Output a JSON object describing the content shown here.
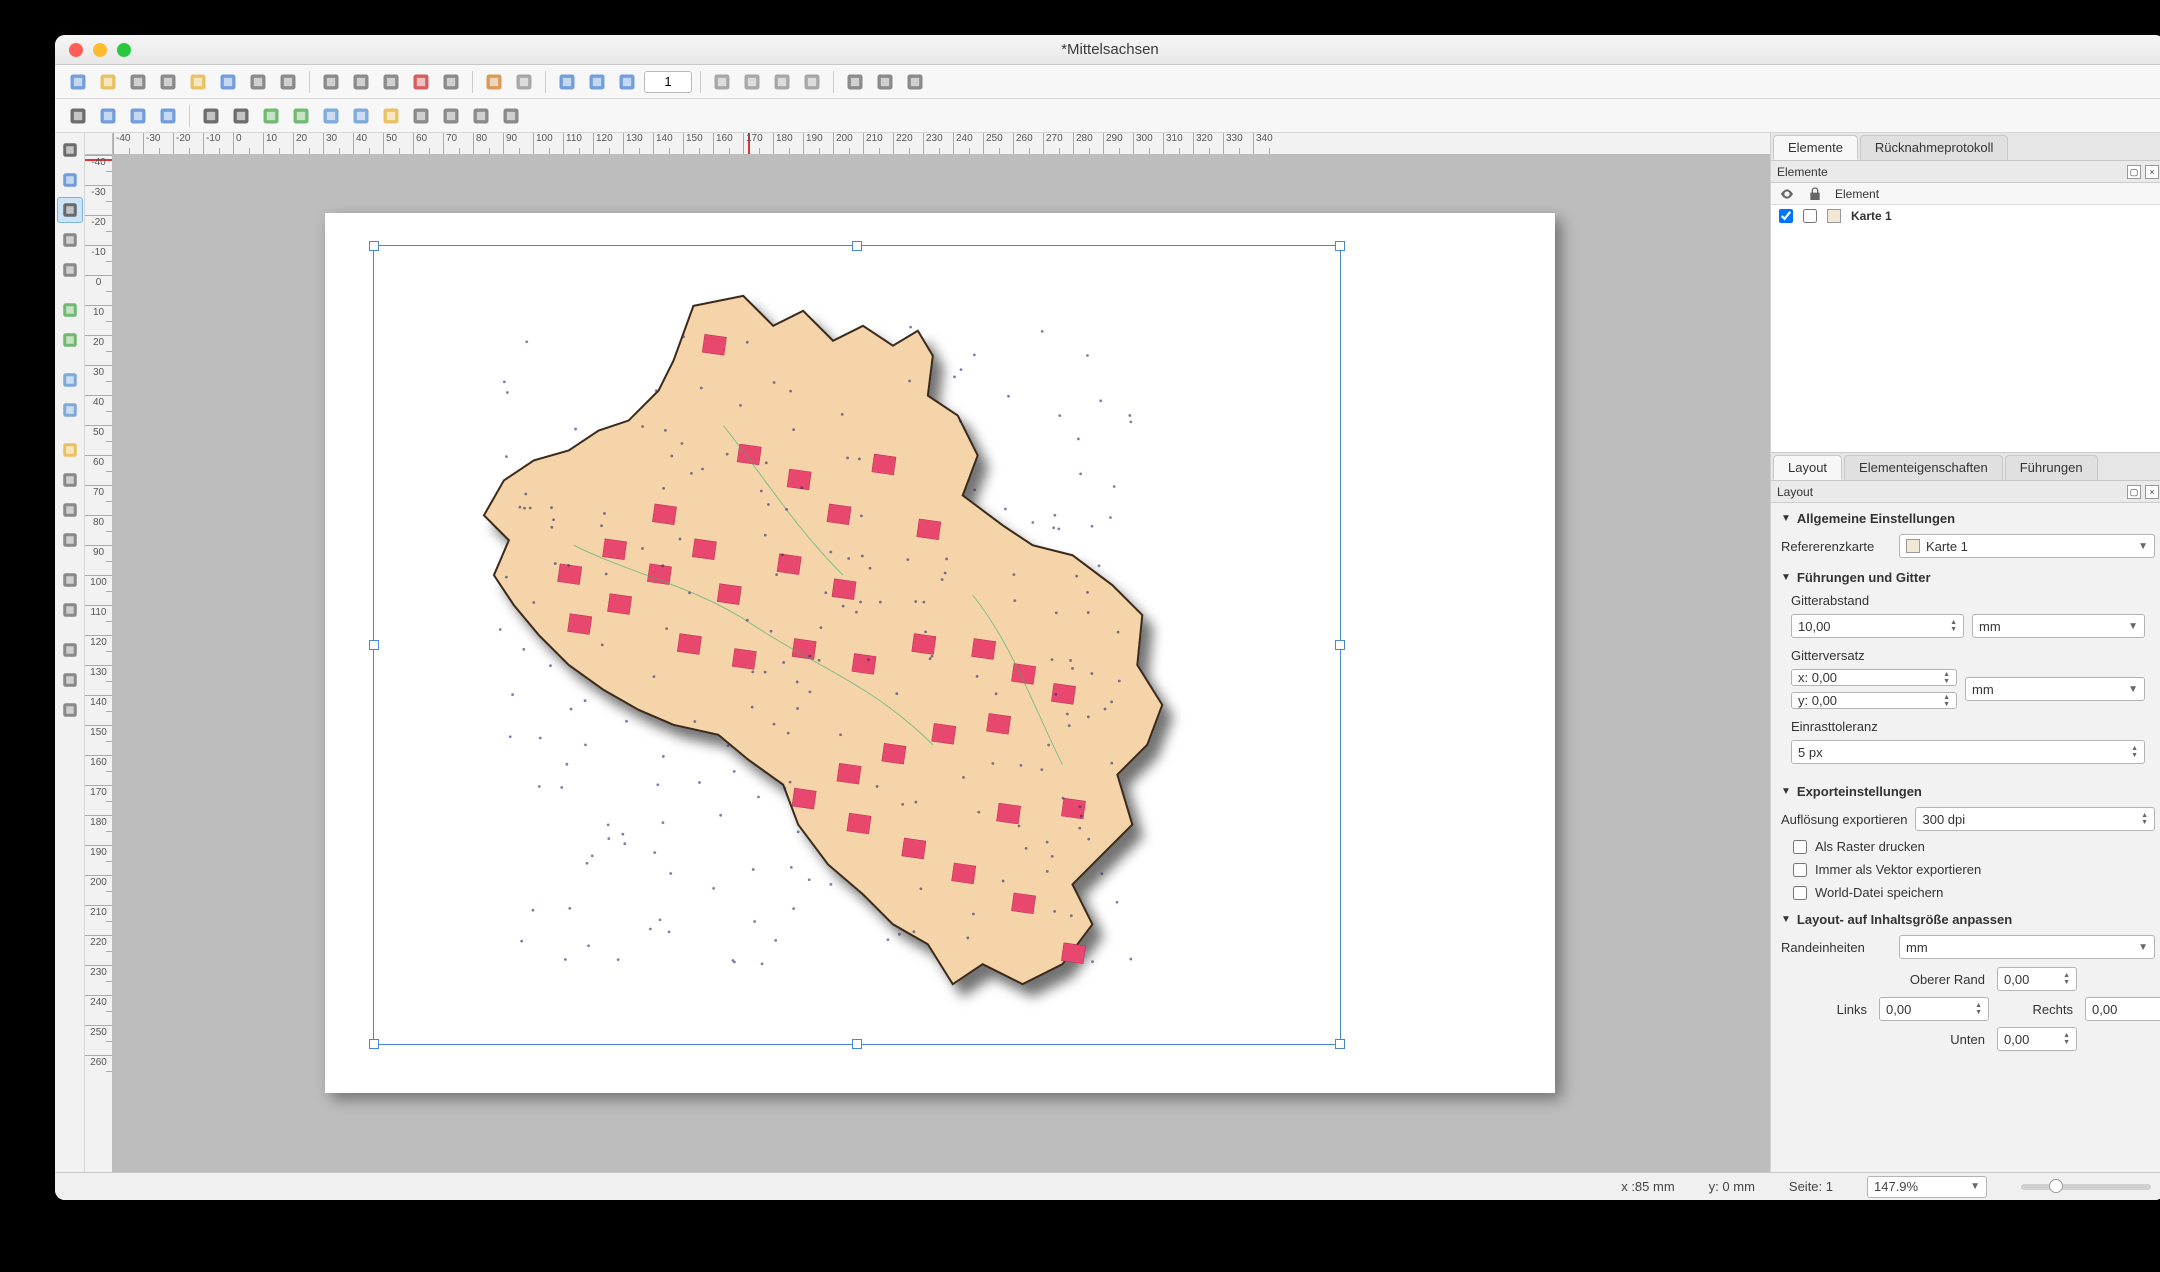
{
  "window": {
    "title": "*Mittelsachsen"
  },
  "toolbar1": {
    "buttons": [
      "save-layout",
      "new-layout",
      "duplicate-layout",
      "layout-manager",
      "open-template",
      "save-template",
      "layout-options",
      "add-items",
      "sep",
      "print",
      "print-preview",
      "print-layers",
      "export-pdf",
      "export-svg",
      "sep",
      "undo",
      "redo",
      "sep",
      "zoom-full",
      "zoom-in",
      "zoom-out",
      "pageno-input",
      "sep",
      "nav-first",
      "nav-prev",
      "nav-next",
      "nav-last",
      "sep",
      "atlas-export",
      "atlas-settings",
      "atlas-toggle"
    ],
    "page_number": "1"
  },
  "toolbar2": {
    "buttons": [
      "pan",
      "zoom",
      "zoom-actual",
      "refresh",
      "sep",
      "select",
      "select-all",
      "add-map",
      "add-3dmap",
      "add-image",
      "add-label",
      "add-legend",
      "add-scalebar",
      "add-northarrow",
      "add-shape",
      "add-arrow"
    ]
  },
  "left_tools": [
    "pan-tool",
    "zoom-tool",
    "select-tool",
    "move-content-tool",
    "edit-nodes-tool",
    "spacer",
    "add-map-tool",
    "add-3dmap-tool",
    "spacer",
    "add-image-tool",
    "add-label-tool",
    "spacer",
    "add-legend-tool",
    "add-scalebar-tool",
    "add-northarrow-tool",
    "add-shape-tool",
    "spacer",
    "add-arrow-tool",
    "add-nodeitem-tool",
    "spacer",
    "add-html-tool",
    "add-table-tool",
    "add-fixedtable-tool"
  ],
  "left_selected_index": 2,
  "ruler": {
    "start": -40,
    "end": 340,
    "step": 10
  },
  "tabs_top": {
    "tabs": [
      "Elemente",
      "Rücknahmeprotokoll"
    ],
    "active": 0
  },
  "elements_panel": {
    "title": "Elemente",
    "header_cols": "Element",
    "items": [
      {
        "checked": true,
        "label": "Karte 1",
        "bold": true
      }
    ]
  },
  "tabs_bottom": {
    "tabs": [
      "Layout",
      "Elementeigenschaften",
      "Führungen"
    ],
    "active": 0
  },
  "layout_panel": {
    "title": "Layout",
    "sections": {
      "general": {
        "title": "Allgemeine Einstellungen",
        "ref_label": "Refererenzkarte",
        "ref_value": "Karte 1"
      },
      "guides": {
        "title": "Führungen und Gitter",
        "grid_spacing_label": "Gitterabstand",
        "grid_spacing_value": "10,00",
        "grid_spacing_unit": "mm",
        "grid_offset_label": "Gitterversatz",
        "grid_offset_x": "x: 0,00",
        "grid_offset_y": "y: 0,00",
        "grid_offset_unit": "mm",
        "snap_label": "Einrasttoleranz",
        "snap_value": "5 px"
      },
      "export": {
        "title": "Exporteinstellungen",
        "dpi_label": "Auflösung exportieren",
        "dpi_value": "300 dpi",
        "raster_label": "Als Raster drucken",
        "vector_label": "Immer als Vektor exportieren",
        "world_label": "World-Datei speichern"
      },
      "resize": {
        "title": "Layout- auf Inhaltsgröße anpassen",
        "unit_label": "Randeinheiten",
        "unit_value": "mm",
        "top_label": "Oberer Rand",
        "top_value": "0,00",
        "left_label": "Links",
        "left_value": "0,00",
        "right_label": "Rechts",
        "right_value": "0,00",
        "bottom_label": "Unten",
        "bottom_value": "0,00"
      }
    }
  },
  "status": {
    "x": "x :85 mm",
    "y": "y: 0 mm",
    "page": "Seite: 1",
    "zoom": "147.9%"
  }
}
